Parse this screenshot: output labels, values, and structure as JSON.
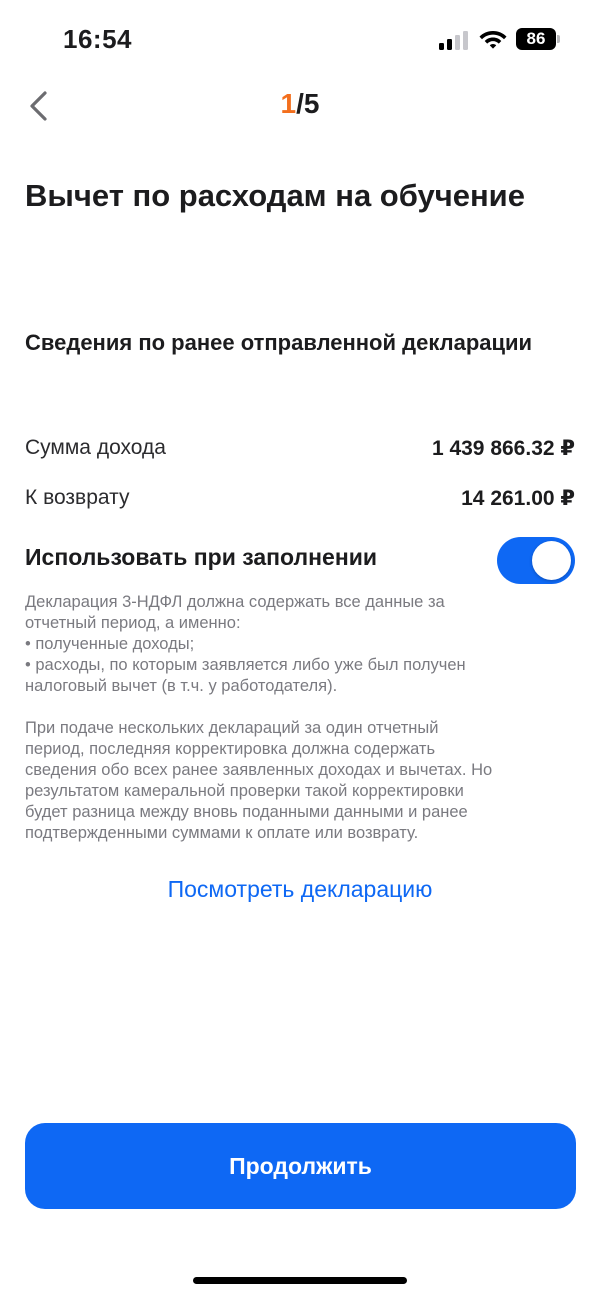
{
  "status_bar": {
    "time": "16:54",
    "battery_level": "86",
    "icons": [
      "signal-icon",
      "wifi-icon",
      "battery-icon"
    ]
  },
  "nav": {
    "step_current": "1",
    "step_separator": "/",
    "step_total": "5",
    "back_icon": "chevron-left-icon"
  },
  "page": {
    "title": "Вычет по расходам на обучение"
  },
  "previous_declaration": {
    "section_title": "Сведения по ранее отправленной декларации",
    "rows": [
      {
        "label": "Сумма дохода",
        "value": "1 439 866.32 ₽"
      },
      {
        "label": "К возврату",
        "value": "14 261.00 ₽"
      }
    ],
    "toggle_label": "Использовать при заполнении",
    "toggle_on": true,
    "description_lines": [
      "Декларация 3-НДФЛ должна содержать все данные за",
      "отчетный период, а именно:",
      "• полученные доходы;",
      "• расходы, по которым заявляется либо уже был получен",
      "налоговый вычет (в т.ч. у работодателя)."
    ],
    "description_lines_2": [
      "При подаче нескольких деклараций за один отчетный",
      "период, последняя корректировка должна содержать",
      "сведения обо всех ранее заявленных доходах и вычетах. Но",
      "результатом камеральной проверки такой корректировки",
      "будет разница между вновь поданными данными и ранее",
      "подтвержденными суммами к оплате или возврату."
    ],
    "view_link": "Посмотреть декларацию"
  },
  "footer": {
    "continue_label": "Продолжить"
  },
  "colors": {
    "accent": "#0e68f4",
    "step_highlight": "#f36f1d",
    "text_primary": "#1c1c1e",
    "text_secondary": "#7a7a80"
  }
}
